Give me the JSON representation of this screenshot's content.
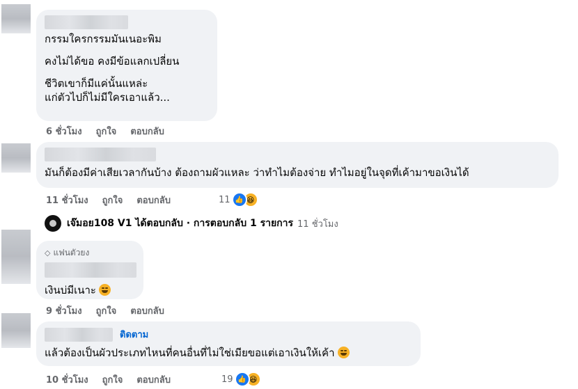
{
  "comments": [
    {
      "lines": [
        "กรรมใครกรรมมันเนอะพิม",
        "คงไม่ได้ขอ คงมีข้อแลกเปลี่ยน",
        "ชีวิตเขาก็มีแค่นั้นแหล่ะ",
        "แก่ตัวไปก็ไม่มีใครเอาแล้ว..."
      ],
      "time": "6 ชั่วโมง",
      "like": "ถูกใจ",
      "reply": "ตอบกลับ"
    },
    {
      "lines": [
        "มันก็ต้องมีค่าเสียเวลากันบ้าง ต้องถามผัวแหละ ว่าทำไมต้องจ่าย ทำไมอยู่ในจุดที่เค้ามาขอเงินได้"
      ],
      "time": "11 ชั่วโมง",
      "like": "ถูกใจ",
      "reply": "ตอบกลับ",
      "reaction_count": "11",
      "reply_summary": {
        "text": "เจ๊มอย108 V1 ได้ตอบกลับ · การตอบกลับ 1 รายการ",
        "time": "11 ชั่วโมง"
      }
    },
    {
      "badge": "แฟนตัวยง",
      "lines": [
        "เงินบ่มีเนาะ"
      ],
      "time": "9 ชั่วโมง",
      "like": "ถูกใจ",
      "reply": "ตอบกลับ"
    },
    {
      "follow": "ติดตาม",
      "lines": [
        "แล้วต้องเป็นผัวประเภทไหนที่คนอื่นที่ไม่ใช่เมียขอแต่เอาเงินให้เค้า"
      ],
      "time": "10 ชั่วโมง",
      "like": "ถูกใจ",
      "reply": "ตอบกลับ",
      "reaction_count": "19"
    }
  ],
  "colors": {
    "bubble": "#f0f2f5",
    "meta": "#65676b",
    "like_blue": "#1877f2",
    "haha_yellow": "#f7b125",
    "follow_blue": "#0064d1"
  },
  "icons": {
    "like": "like-icon",
    "haha": "haha-icon",
    "diamond": "diamond-icon"
  }
}
